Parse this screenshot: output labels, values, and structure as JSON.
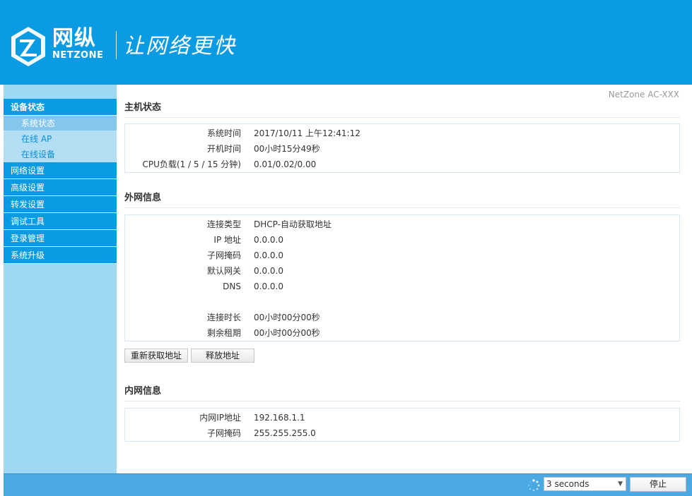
{
  "header": {
    "brand_cn": "网纵",
    "brand_en": "NETZONE",
    "slogan": "让网络更快"
  },
  "sidebar": {
    "groups": [
      {
        "label": "设备状态",
        "active": true,
        "subitems": [
          "系统状态",
          "在线 AP",
          "在线设备"
        ]
      },
      {
        "label": "网络设置"
      },
      {
        "label": "高级设置"
      },
      {
        "label": "转发设置"
      },
      {
        "label": "调试工具"
      },
      {
        "label": "登录管理"
      },
      {
        "label": "系统升级"
      }
    ]
  },
  "main": {
    "device_name": "NetZone AC-XXX",
    "host_status": {
      "title": "主机状态",
      "rows": [
        {
          "k": "系统时间",
          "v": "2017/10/11 上午12:41:12"
        },
        {
          "k": "开机时间",
          "v": "00小时15分49秒"
        },
        {
          "k": "CPU负载(1 / 5 / 15 分钟)",
          "v": "0.01/0.02/0.00"
        }
      ]
    },
    "wan_info": {
      "title": "外网信息",
      "rows": [
        {
          "k": "连接类型",
          "v": "DHCP-自动获取地址"
        },
        {
          "k": "IP 地址",
          "v": "0.0.0.0"
        },
        {
          "k": "子网掩码",
          "v": "0.0.0.0"
        },
        {
          "k": "默认网关",
          "v": "0.0.0.0"
        },
        {
          "k": "DNS",
          "v": "0.0.0.0"
        },
        {
          "k": "连接时长",
          "v": "00小时00分00秒"
        },
        {
          "k": "剩余租期",
          "v": "00小时00分00秒"
        }
      ],
      "renew_label": "重新获取地址",
      "release_label": "释放地址"
    },
    "lan_info": {
      "title": "内网信息",
      "rows": [
        {
          "k": "内网IP地址",
          "v": "192.168.1.1"
        },
        {
          "k": "子网掩码",
          "v": "255.255.255.0"
        }
      ]
    }
  },
  "footer": {
    "refresh_select": "3 seconds",
    "stop_label": "停止"
  },
  "colors": {
    "primary": "#0a9be3",
    "sidebar_bg": "#9fd8f5"
  }
}
